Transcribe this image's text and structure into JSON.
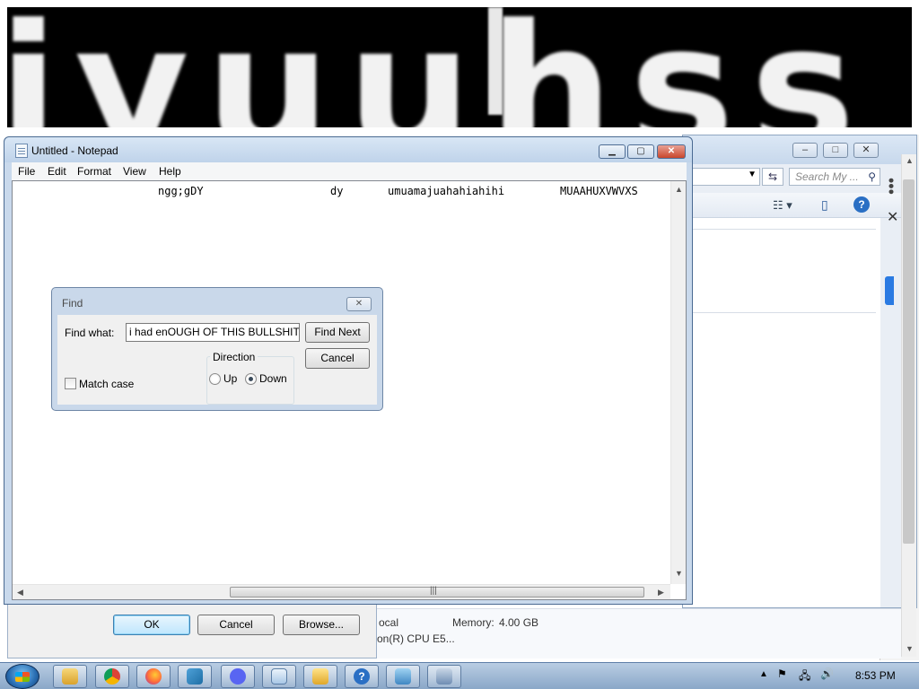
{
  "banner": {
    "text": "iyuuhss"
  },
  "explorer": {
    "search_placeholder": "Search My ...",
    "refresh_icon": "refresh-icon",
    "view_icon": "view-options-icon",
    "preview_icon": "preview-pane-icon",
    "help_icon": "help-icon"
  },
  "notepad": {
    "title": "Untitled - Notepad",
    "menu": [
      "File",
      "Edit",
      "Format",
      "View",
      "Help"
    ],
    "line_segments": [
      "ngg;gDY",
      "dy",
      "umuamajuahahiahihi",
      "MUAAHUXVWVXS"
    ]
  },
  "find": {
    "title": "Find",
    "find_what_label": "Find what:",
    "find_what_value": "i had  enOUGH OF THIS BULLSHIT!!!!",
    "find_next_label": "Find Next",
    "cancel_label": "Cancel",
    "direction_label": "Direction",
    "up_label": "Up",
    "down_label": "Down",
    "direction_selected": "Down",
    "match_case_label": "Match case",
    "match_case_checked": false
  },
  "background_dialog": {
    "ok_label": "OK",
    "cancel_label": "Cancel",
    "browse_label": "Browse..."
  },
  "system_info": {
    "partial_local": "ocal",
    "memory_label": "Memory:",
    "memory_value": "4.00 GB",
    "cpu_partial": "on(R) CPU E5..."
  },
  "taskbar": {
    "items": [
      "explorer-icon",
      "chrome-icon",
      "firefox-icon",
      "vmware-icon",
      "discord-icon",
      "notepad-icon",
      "folder-window-icon",
      "help-icon",
      "remote-desktop-icon",
      "network-settings-icon"
    ],
    "clock": "8:53 PM"
  }
}
